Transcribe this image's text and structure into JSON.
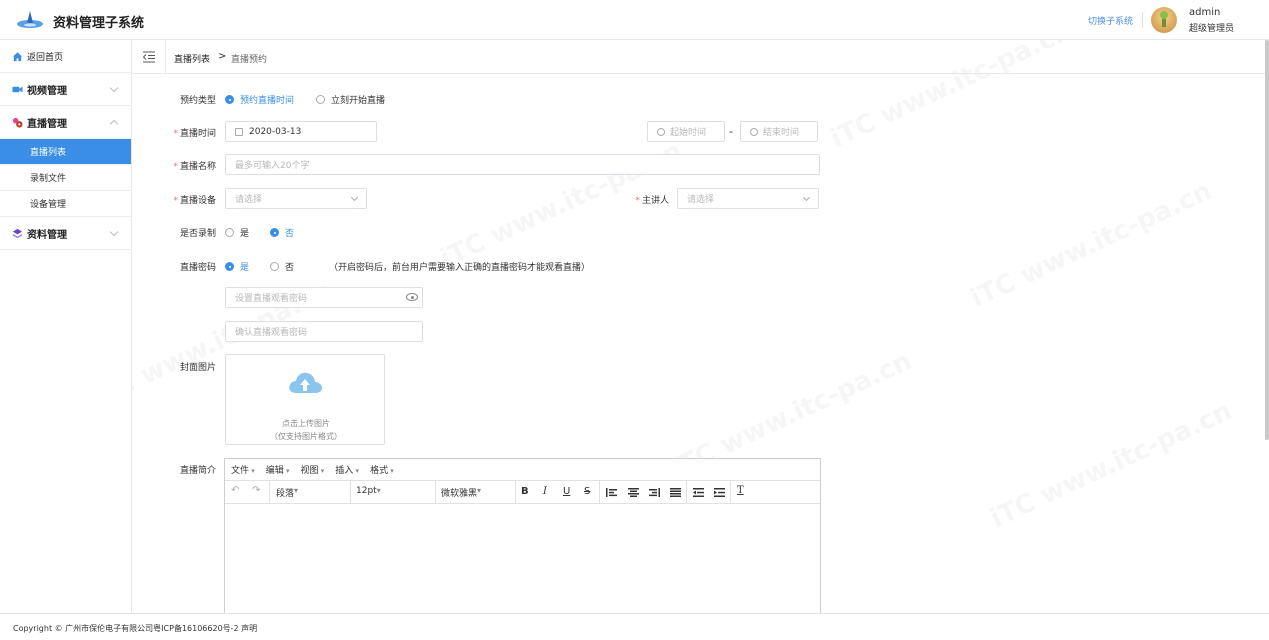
{
  "header": {
    "title": "资料管理子系统",
    "switch_label": "切换子系统",
    "user_name": "admin",
    "user_role": "超级管理员"
  },
  "sidebar": {
    "home": "返回首页",
    "groups": [
      {
        "label": "视频管理",
        "expanded": false
      },
      {
        "label": "直播管理",
        "expanded": true,
        "children": [
          "直播列表",
          "录制文件",
          "设备管理"
        ]
      },
      {
        "label": "资料管理",
        "expanded": false
      }
    ],
    "active_child": "直播列表"
  },
  "breadcrumb": {
    "parent": "直播列表",
    "separator": ">",
    "current": "直播预约"
  },
  "form": {
    "type": {
      "label": "预约类型",
      "options": [
        "预约直播时间",
        "立刻开始直播"
      ],
      "selected": "预约直播时间"
    },
    "time": {
      "label": "直播时间",
      "date": "2020-03-13",
      "start_placeholder": "起始时间",
      "end_placeholder": "结束时间",
      "range_sep": "-"
    },
    "name": {
      "label": "直播名称",
      "placeholder": "最多可输入20个字"
    },
    "device": {
      "label": "直播设备",
      "placeholder": "请选择"
    },
    "speaker": {
      "label": "主讲人",
      "placeholder": "请选择"
    },
    "record": {
      "label": "是否录制",
      "options": [
        "是",
        "否"
      ],
      "selected": "否"
    },
    "password": {
      "label": "直播密码",
      "options": [
        "是",
        "否"
      ],
      "selected": "是",
      "hint": "（开启密码后，前台用户需要输入正确的直播密码才能观看直播）",
      "set_placeholder": "设置直播观看密码",
      "confirm_placeholder": "确认直播观看密码"
    },
    "cover": {
      "label": "封面图片",
      "line1": "点击上传图片",
      "line2": "（仅支持图片格式）"
    },
    "intro": {
      "label": "直播简介"
    }
  },
  "editor": {
    "menus": [
      "文件",
      "编辑",
      "视图",
      "插入",
      "格式"
    ],
    "block_format": "段落",
    "font_size": "12pt",
    "font_family": "微软雅黑",
    "buttons": {
      "undo": "↶",
      "redo": "↷",
      "bold": "B",
      "italic": "I",
      "underline": "U",
      "strike": "S",
      "clear_format": "T"
    }
  },
  "footer": {
    "copyright": "Copyright © 广州市保伦电子有限公司粤ICP备16106620号-2 声明"
  },
  "watermark": "iTC www.itc-pa.cn",
  "colors": {
    "accent": "#3a8ee6",
    "required": "#f56c6c"
  }
}
